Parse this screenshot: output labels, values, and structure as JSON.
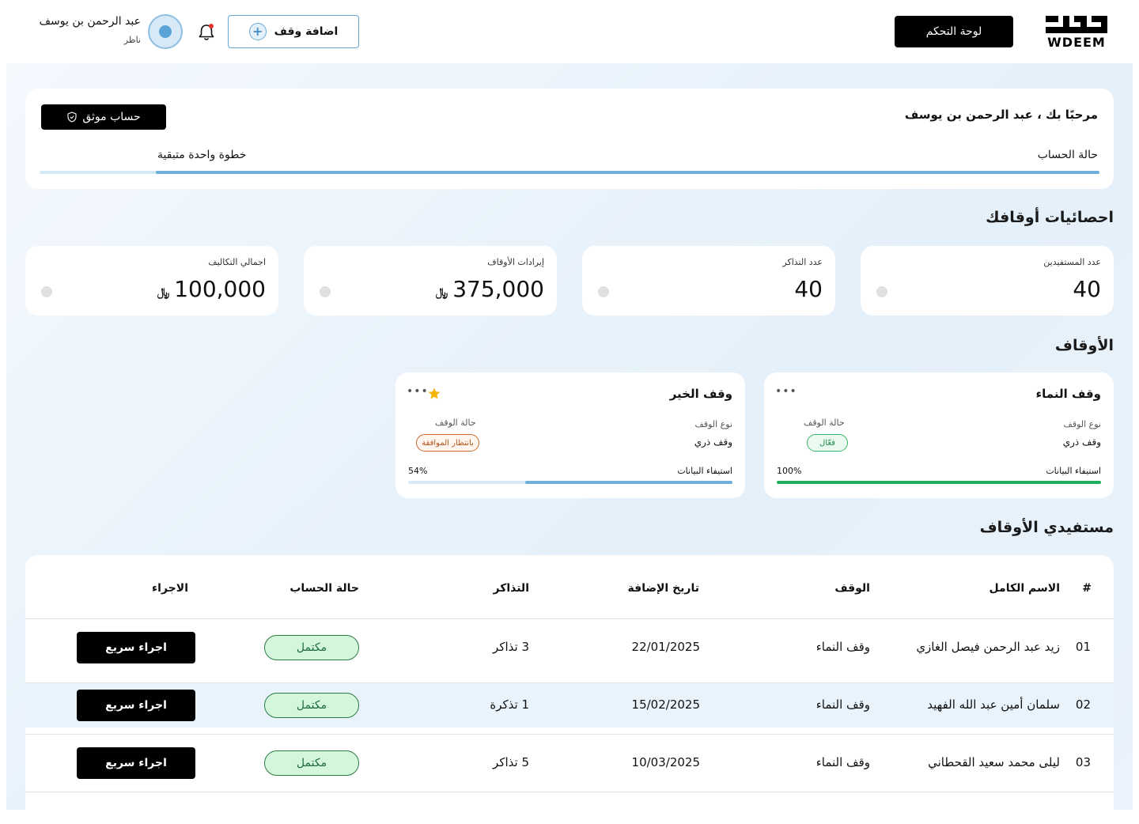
{
  "header": {
    "logo_text": "WDEEM",
    "dashboard_label": "لوحة التحكم",
    "add_waqf_label": "اضافة وقف",
    "user_name": "عبد الرحمن بن يوسف",
    "user_role": "ناظر"
  },
  "welcome": {
    "title": "مرحبًا بك ، عبد الرحمن بن يوسف",
    "verified_label": "حساب موثق",
    "account_status_label": "حالة الحساب",
    "step_label": "خطوة واحدة متبقية",
    "progress": 0.89
  },
  "stats": {
    "section_title": "احصائيات أوقافك",
    "items": [
      {
        "label": "عدد المستفيدين",
        "value": "40",
        "currency": ""
      },
      {
        "label": "عدد التذاكر",
        "value": "40",
        "currency": ""
      },
      {
        "label": "إيرادات الأوقاف",
        "value": "375,000",
        "currency": "﷼"
      },
      {
        "label": "اجمالي التكاليف",
        "value": "100,000",
        "currency": "﷼"
      }
    ]
  },
  "awqaf": {
    "section_title": "الأوقاف",
    "items": [
      {
        "name": "وقف النماء",
        "type_label": "نوع الوقف",
        "type": "وقف ذري",
        "state_label": "حالة الوقف",
        "state": "فعّال",
        "data_label": "استيفاء البيانات",
        "pct_text": "100%",
        "progress": 1.0,
        "favorite": false,
        "bar_color": "#1fae5c"
      },
      {
        "name": "وقف الخير",
        "type_label": "نوع الوقف",
        "type": "وقف ذري",
        "state_label": "حالة الوقف",
        "state": "بانتظار الموافقة",
        "data_label": "استيفاء البيانات",
        "pct_text": "54%",
        "progress": 0.64,
        "favorite": true,
        "bar_color": "#6fb0da"
      }
    ]
  },
  "beneficiaries": {
    "section_title": "مستفيدي الأوقاف",
    "columns": [
      "#",
      "الاسم الكامل",
      "الوقف",
      "تاريخ الإضافة",
      "التذاكر",
      "حالة الحساب",
      "الاجراء"
    ],
    "rows": [
      {
        "num": "01",
        "name": "زيد عبد الرحمن فيصل الغازي",
        "waqf": "وقف النماء",
        "date": "22/01/2025",
        "tickets": "3 تذاكر",
        "status": "مكتمل",
        "action": "اجراء سريع"
      },
      {
        "num": "02",
        "name": "سلمان أمين عبد الله الفهيد",
        "waqf": "وقف النماء",
        "date": "15/02/2025",
        "tickets": "1 تذكرة",
        "status": "مكتمل",
        "action": "اجراء سريع"
      },
      {
        "num": "03",
        "name": "ليلى محمد سعيد القحطاني",
        "waqf": "وقف النماء",
        "date": "10/03/2025",
        "tickets": "5 تذاكر",
        "status": "مكتمل",
        "action": "اجراء سريع"
      }
    ]
  },
  "colors": {
    "accent": "#6fb0da",
    "success": "#1fae5c",
    "pending": "#c76b2f",
    "primary_button": "#000000"
  },
  "icons": [
    "logo-mark",
    "plus-circle-icon",
    "bell-icon",
    "avatar-icon",
    "shield-check-icon",
    "more-icon",
    "star-icon"
  ]
}
